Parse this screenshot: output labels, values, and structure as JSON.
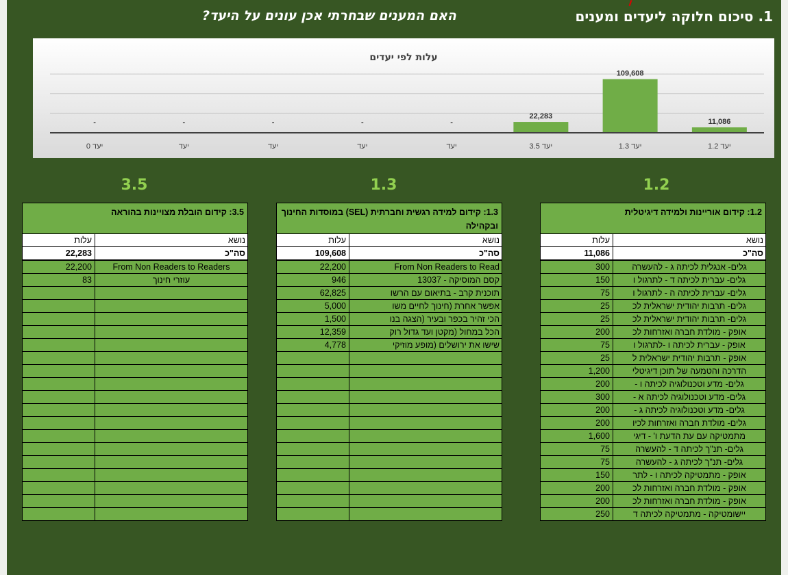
{
  "header": {
    "main_title": "1. סיכום חלוקה ליעדים ומענים",
    "question": "האם המענים שבחרתי אכן עונים על היעד?"
  },
  "colors": {
    "background": "#375623",
    "cell_green": "#70ad47",
    "accent_green": "#92d050",
    "bar_green": "#70ad47"
  },
  "chart_data": {
    "type": "bar",
    "title": "עלות לפי יעדים",
    "categories": [
      "יעד 1.2",
      "יעד 1.3",
      "יעד 3.5",
      "יעד",
      "יעד",
      "יעד",
      "יעד",
      "יעד 0"
    ],
    "values": [
      11086,
      109608,
      22283,
      0,
      0,
      0,
      0,
      0
    ],
    "labels": [
      "11,086",
      "109,608",
      "22,283",
      "-",
      "-",
      "-",
      "-",
      "-"
    ],
    "ylim": [
      0,
      130000
    ],
    "grid": true
  },
  "blocks": [
    {
      "number": "1.2",
      "title": "1.2: קידום אוריינות ולמידה דיגיטלית",
      "col_topic": "נושא",
      "col_cost": "עלות",
      "total_label": "סה\"כ",
      "total_value": "11,086",
      "rows": [
        [
          "גלים- אנגלית לכיתה ג - להעשרה",
          "300"
        ],
        [
          "גלים- עברית לכיתה ד - לתרגול ו",
          "150"
        ],
        [
          "גלים- עברית לכיתה ה - לתרגול ו",
          "75"
        ],
        [
          "גלים- תרבות יהודית ישראלית לכ",
          "25"
        ],
        [
          "גלים- תרבות יהודית ישראלית לכ",
          "25"
        ],
        [
          "אופק - מולדת חברה ואזרחות לכ",
          "200"
        ],
        [
          "אופק - עברית לכיתה ו -לתרגול ו",
          "75"
        ],
        [
          "אופק - תרבות יהודית ישראלית ל",
          "25"
        ],
        [
          "הדרכה והטמעה של תוכן דיגיטלי",
          "1,200"
        ],
        [
          "גלים- מדע וטכנולוגיה לכיתה ו -",
          "200"
        ],
        [
          "גלים- מדע וטכנולוגיה לכיתה א -",
          "300"
        ],
        [
          "גלים- מדע וטכנולוגיה לכיתה ג -",
          "200"
        ],
        [
          "גלים- מולדת חברה ואזרחות לכיו",
          "200"
        ],
        [
          "מתמטיקה עם עת הדעת ו' - דיגי",
          "1,600"
        ],
        [
          "גלים- תנ\"ך לכיתה ד - להעשרה",
          "75"
        ],
        [
          "גלים- תנ\"ך לכיתה ג - להעשרה",
          "75"
        ],
        [
          "אופק - מתמטיקה לכיתה ו - לתר",
          "150"
        ],
        [
          "אופק - מולדת חברה ואזרחות לכ",
          "200"
        ],
        [
          "אופק - מולדת חברה ואזרחות לכ",
          "200"
        ],
        [
          "יישומטיקה - מתמטיקה לכיתה ד",
          "250"
        ]
      ]
    },
    {
      "number": "1.3",
      "title": "1.3: קידום למידה רגשית וחברתית (SEL) במוסדות החינוך ובקהילה",
      "col_topic": "נושא",
      "col_cost": "עלות",
      "total_label": "סה\"כ",
      "total_value": "109,608",
      "rows": [
        [
          "From Non Readers to Read",
          "22,200"
        ],
        [
          "קסם המוסיקה - 13037",
          "946"
        ],
        [
          "תוכנית קרב - בתיאום עם הרשו",
          "62,825"
        ],
        [
          "אפשר אחרת (חינוך לחיים משו",
          "5,000"
        ],
        [
          "הכי זהיר בכפר ובעיר (הצגה בנו",
          "1,500"
        ],
        [
          "הכל במחול (מקטן ועד גדול רוק",
          "12,359"
        ],
        [
          "שישו את ירושלים (מופע מוזיקי",
          "4,778"
        ],
        [
          "",
          ""
        ],
        [
          "",
          ""
        ],
        [
          "",
          ""
        ],
        [
          "",
          ""
        ],
        [
          "",
          ""
        ],
        [
          "",
          ""
        ],
        [
          "",
          ""
        ],
        [
          "",
          ""
        ],
        [
          "",
          ""
        ],
        [
          "",
          ""
        ],
        [
          "",
          ""
        ],
        [
          "",
          ""
        ],
        [
          "",
          ""
        ]
      ]
    },
    {
      "number": "3.5",
      "title": "3.5: קידום הובלת מצויינות בהוראה",
      "col_topic": "נושא",
      "col_cost": "עלות",
      "total_label": "סה\"כ",
      "total_value": "22,283",
      "rows": [
        [
          "From Non Readers to Readers",
          "22,200"
        ],
        [
          "עוזרי חינוך",
          "83"
        ],
        [
          "",
          ""
        ],
        [
          "",
          ""
        ],
        [
          "",
          ""
        ],
        [
          "",
          ""
        ],
        [
          "",
          ""
        ],
        [
          "",
          ""
        ],
        [
          "",
          ""
        ],
        [
          "",
          ""
        ],
        [
          "",
          ""
        ],
        [
          "",
          ""
        ],
        [
          "",
          ""
        ],
        [
          "",
          ""
        ],
        [
          "",
          ""
        ],
        [
          "",
          ""
        ],
        [
          "",
          ""
        ],
        [
          "",
          ""
        ],
        [
          "",
          ""
        ],
        [
          "",
          ""
        ]
      ]
    }
  ]
}
